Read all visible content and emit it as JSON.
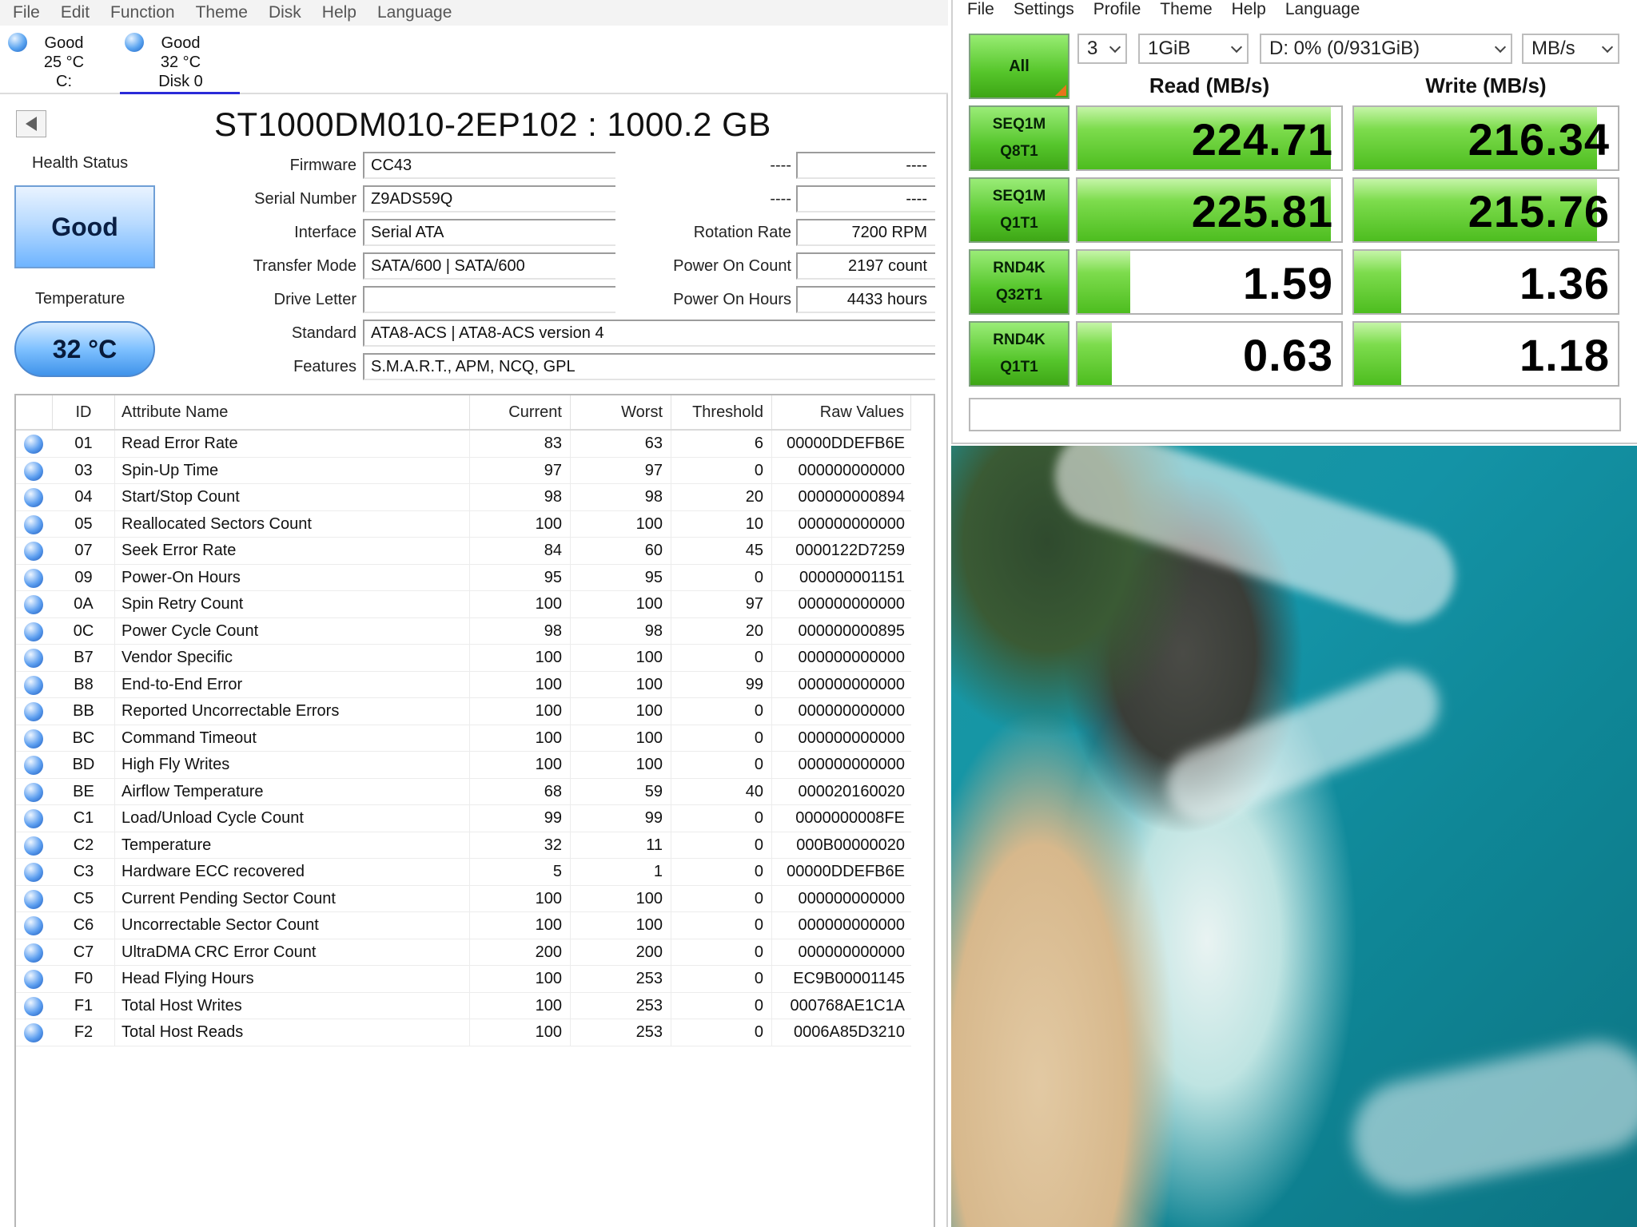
{
  "cdi": {
    "menu": [
      "File",
      "Edit",
      "Function",
      "Theme",
      "Disk",
      "Help",
      "Language"
    ],
    "disks": [
      {
        "status": "Good",
        "temp": "25 °C",
        "name": "C:"
      },
      {
        "status": "Good",
        "temp": "32 °C",
        "name": "Disk 0"
      }
    ],
    "model_title": "ST1000DM010-2EP102 : 1000.2 GB",
    "health_label": "Health Status",
    "health_value": "Good",
    "temp_label": "Temperature",
    "temp_value": "32 °C",
    "info": {
      "firmware_label": "Firmware",
      "firmware": "CC43",
      "serial_label": "Serial Number",
      "serial": "Z9ADS59Q",
      "interface_label": "Interface",
      "interface": "Serial ATA",
      "transfer_label": "Transfer Mode",
      "transfer": "SATA/600 | SATA/600",
      "drive_letter_label": "Drive Letter",
      "drive_letter": "",
      "standard_label": "Standard",
      "standard": "ATA8-ACS | ATA8-ACS version 4",
      "features_label": "Features",
      "features": "S.M.A.R.T., APM, NCQ, GPL",
      "dash1_label": "----",
      "dash1_value": "----",
      "dash2_label": "----",
      "dash2_value": "----",
      "rotation_label": "Rotation Rate",
      "rotation": "7200 RPM",
      "power_count_label": "Power On Count",
      "power_count": "2197 count",
      "power_hours_label": "Power On Hours",
      "power_hours": "4433 hours"
    },
    "smart_headers": {
      "id": "ID",
      "name": "Attribute Name",
      "current": "Current",
      "worst": "Worst",
      "threshold": "Threshold",
      "raw": "Raw Values"
    },
    "smart_rows": [
      {
        "id": "01",
        "name": "Read Error Rate",
        "current": "83",
        "worst": "63",
        "threshold": "6",
        "raw": "00000DDEFB6E"
      },
      {
        "id": "03",
        "name": "Spin-Up Time",
        "current": "97",
        "worst": "97",
        "threshold": "0",
        "raw": "000000000000"
      },
      {
        "id": "04",
        "name": "Start/Stop Count",
        "current": "98",
        "worst": "98",
        "threshold": "20",
        "raw": "000000000894"
      },
      {
        "id": "05",
        "name": "Reallocated Sectors Count",
        "current": "100",
        "worst": "100",
        "threshold": "10",
        "raw": "000000000000"
      },
      {
        "id": "07",
        "name": "Seek Error Rate",
        "current": "84",
        "worst": "60",
        "threshold": "45",
        "raw": "0000122D7259"
      },
      {
        "id": "09",
        "name": "Power-On Hours",
        "current": "95",
        "worst": "95",
        "threshold": "0",
        "raw": "000000001151"
      },
      {
        "id": "0A",
        "name": "Spin Retry Count",
        "current": "100",
        "worst": "100",
        "threshold": "97",
        "raw": "000000000000"
      },
      {
        "id": "0C",
        "name": "Power Cycle Count",
        "current": "98",
        "worst": "98",
        "threshold": "20",
        "raw": "000000000895"
      },
      {
        "id": "B7",
        "name": "Vendor Specific",
        "current": "100",
        "worst": "100",
        "threshold": "0",
        "raw": "000000000000"
      },
      {
        "id": "B8",
        "name": "End-to-End Error",
        "current": "100",
        "worst": "100",
        "threshold": "99",
        "raw": "000000000000"
      },
      {
        "id": "BB",
        "name": "Reported Uncorrectable Errors",
        "current": "100",
        "worst": "100",
        "threshold": "0",
        "raw": "000000000000"
      },
      {
        "id": "BC",
        "name": "Command Timeout",
        "current": "100",
        "worst": "100",
        "threshold": "0",
        "raw": "000000000000"
      },
      {
        "id": "BD",
        "name": "High Fly Writes",
        "current": "100",
        "worst": "100",
        "threshold": "0",
        "raw": "000000000000"
      },
      {
        "id": "BE",
        "name": "Airflow Temperature",
        "current": "68",
        "worst": "59",
        "threshold": "40",
        "raw": "000020160020"
      },
      {
        "id": "C1",
        "name": "Load/Unload Cycle Count",
        "current": "99",
        "worst": "99",
        "threshold": "0",
        "raw": "0000000008FE"
      },
      {
        "id": "C2",
        "name": "Temperature",
        "current": "32",
        "worst": "11",
        "threshold": "0",
        "raw": "000B00000020"
      },
      {
        "id": "C3",
        "name": "Hardware ECC recovered",
        "current": "5",
        "worst": "1",
        "threshold": "0",
        "raw": "00000DDEFB6E"
      },
      {
        "id": "C5",
        "name": "Current Pending Sector Count",
        "current": "100",
        "worst": "100",
        "threshold": "0",
        "raw": "000000000000"
      },
      {
        "id": "C6",
        "name": "Uncorrectable Sector Count",
        "current": "100",
        "worst": "100",
        "threshold": "0",
        "raw": "000000000000"
      },
      {
        "id": "C7",
        "name": "UltraDMA CRC Error Count",
        "current": "200",
        "worst": "200",
        "threshold": "0",
        "raw": "000000000000"
      },
      {
        "id": "F0",
        "name": "Head Flying Hours",
        "current": "100",
        "worst": "253",
        "threshold": "0",
        "raw": "EC9B00001145"
      },
      {
        "id": "F1",
        "name": "Total Host Writes",
        "current": "100",
        "worst": "253",
        "threshold": "0",
        "raw": "000768AE1C1A"
      },
      {
        "id": "F2",
        "name": "Total Host Reads",
        "current": "100",
        "worst": "253",
        "threshold": "0",
        "raw": "0006A85D3210"
      }
    ]
  },
  "cdm": {
    "menu": [
      "File",
      "Settings",
      "Profile",
      "Theme",
      "Help",
      "Language"
    ],
    "all_label": "All",
    "count": "3",
    "size": "1GiB",
    "drive": "D: 0% (0/931GiB)",
    "unit": "MB/s",
    "read_header": "Read (MB/s)",
    "write_header": "Write (MB/s)",
    "tests": [
      {
        "line1": "SEQ1M",
        "line2": "Q8T1",
        "read": "224.71",
        "write": "216.34",
        "read_fill": 0.96,
        "write_fill": 0.92
      },
      {
        "line1": "SEQ1M",
        "line2": "Q1T1",
        "read": "225.81",
        "write": "215.76",
        "read_fill": 0.96,
        "write_fill": 0.92
      },
      {
        "line1": "RND4K",
        "line2": "Q32T1",
        "read": "1.59",
        "write": "1.36",
        "read_fill": 0.2,
        "write_fill": 0.18
      },
      {
        "line1": "RND4K",
        "line2": "Q1T1",
        "read": "0.63",
        "write": "1.18",
        "read_fill": 0.13,
        "write_fill": 0.18
      }
    ],
    "comment": ""
  },
  "colors": {
    "health_blue": "#6eb4ff",
    "bench_green": "#4dbd1f",
    "accent_tab": "#2a2ad8"
  }
}
